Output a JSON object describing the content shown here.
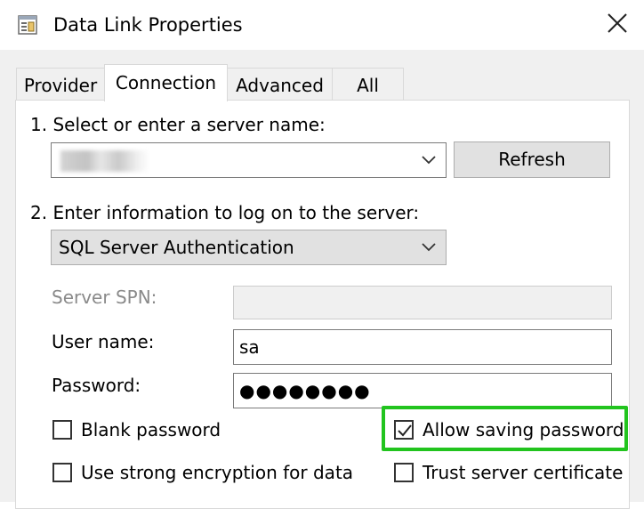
{
  "window": {
    "title": "Data Link Properties",
    "icon": "database-properties-icon",
    "close_icon": "close-icon"
  },
  "tabs": [
    {
      "label": "Provider",
      "active": false
    },
    {
      "label": "Connection",
      "active": true
    },
    {
      "label": "Advanced",
      "active": false
    },
    {
      "label": "All",
      "active": false
    }
  ],
  "connection": {
    "step1_label": "1. Select or enter a server name:",
    "server_name_value": "",
    "refresh_label": "Refresh",
    "step2_label": "2. Enter information to log on to the server:",
    "auth_mode": "SQL Server Authentication",
    "server_spn_label": "Server SPN:",
    "server_spn_value": "",
    "username_label": "User name:",
    "username_value": "sa",
    "password_label": "Password:",
    "password_value": "●●●●●●●●",
    "checkboxes": {
      "blank_password": {
        "label": "Blank password",
        "checked": false
      },
      "allow_saving_password": {
        "label": "Allow saving password",
        "checked": true
      },
      "strong_encryption": {
        "label": "Use strong encryption for data",
        "checked": false
      },
      "trust_server_certificate": {
        "label": "Trust server certificate",
        "checked": false
      }
    }
  },
  "colors": {
    "highlight": "#22c41e",
    "dialog_bg": "#f0f0f0",
    "panel_bg": "#ffffff"
  }
}
